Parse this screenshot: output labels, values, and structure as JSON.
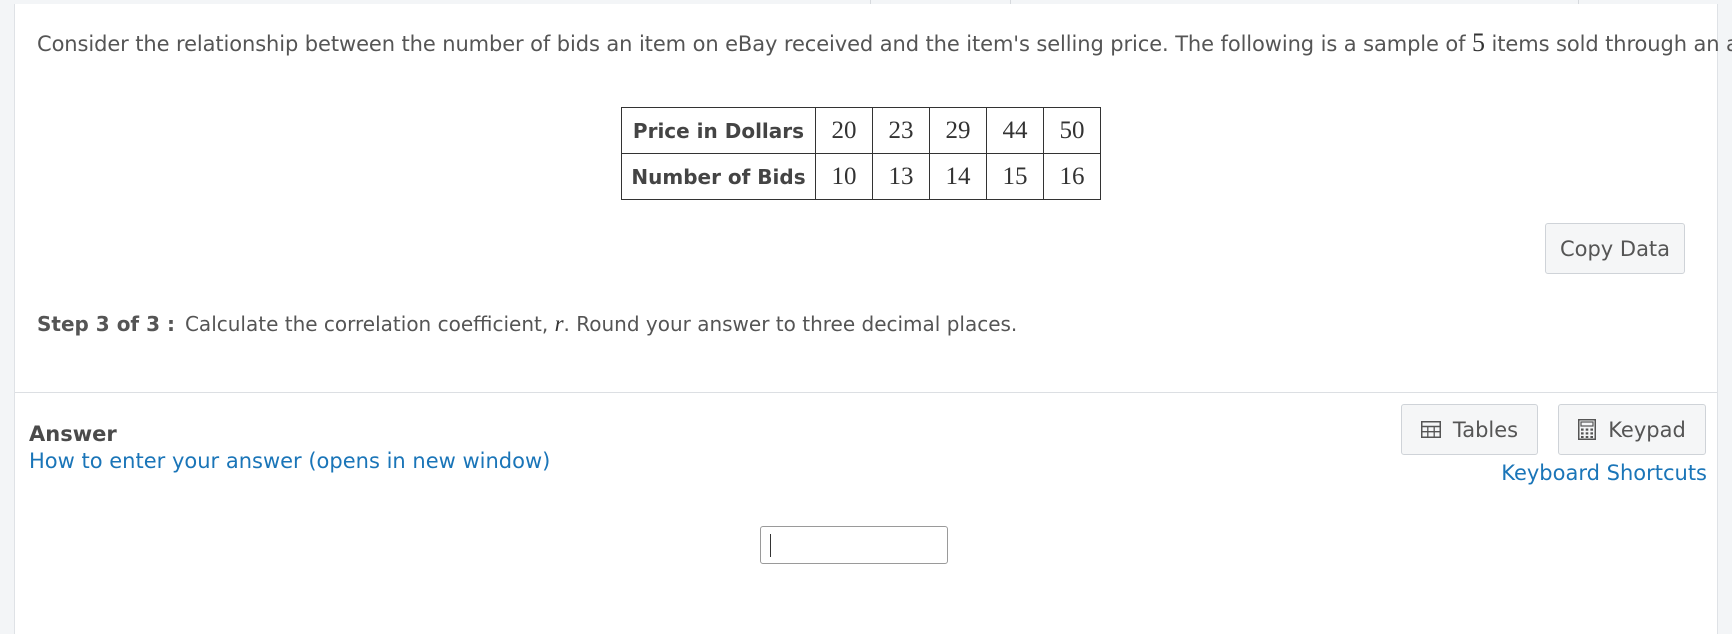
{
  "question": {
    "text_before": "Consider the relationship between the number of bids an item on eBay received and the item's selling price. The following is a sample of ",
    "sample_size": "5",
    "text_after": " items sold through an auction."
  },
  "table": {
    "rows": [
      {
        "label": "Price in Dollars",
        "values": [
          "20",
          "23",
          "29",
          "44",
          "50"
        ]
      },
      {
        "label": "Number of Bids",
        "values": [
          "10",
          "13",
          "14",
          "15",
          "16"
        ]
      }
    ]
  },
  "copy_data_label": "Copy Data",
  "step": {
    "label": "Step 3 of 3 :",
    "text_before": "Calculate the correlation coefficient, ",
    "variable": "r",
    "text_after": ". Round your answer to three decimal places."
  },
  "answer": {
    "heading": "Answer",
    "help_link": "How to enter your answer (opens in new window)",
    "tables_label": "Tables",
    "keypad_label": "Keypad",
    "shortcuts_link": "Keyboard Shortcuts",
    "input_value": ""
  },
  "icons": {
    "tables": "table-grid-icon",
    "keypad": "calculator-icon"
  },
  "colors": {
    "link": "#1a75b8",
    "text": "#555555",
    "button_bg": "#f5f6f7",
    "page_bg": "#f3f5f7"
  }
}
